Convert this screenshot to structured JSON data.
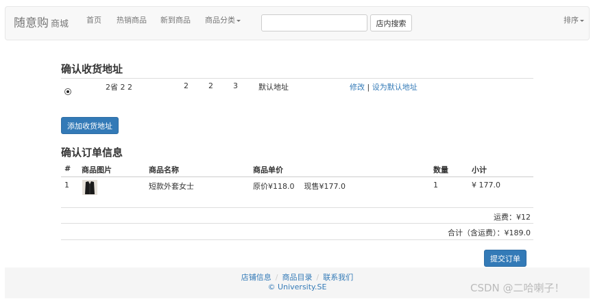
{
  "navbar": {
    "brand": "随意购",
    "brand_sub": "商城",
    "links": [
      "首页",
      "热销商品",
      "新到商品"
    ],
    "category_dropdown": "商品分类",
    "search_value": "",
    "search_placeholder": "",
    "search_button": "店内搜索",
    "sort_dropdown": "排序"
  },
  "address_section": {
    "title": "确认收货地址",
    "address": {
      "region": "2省 2 2",
      "field1": "2",
      "field2": "2",
      "field3": "3",
      "label": "默认地址",
      "edit_link": "修改",
      "separator": "|",
      "set_default_link": "设为默认地址",
      "selected": true
    },
    "add_button": "添加收货地址"
  },
  "order_section": {
    "title": "确认订单信息",
    "headers": [
      "#",
      "商品图片",
      "商品名称",
      "商品单价",
      "数量",
      "小计"
    ],
    "rows": [
      {
        "index": "1",
        "name": "短款外套女士",
        "price_text": "原价¥118.0    现售¥177.0",
        "quantity": "1",
        "subtotal": "¥ 177.0"
      }
    ],
    "shipping": "运费：¥12",
    "total": "合计（含运费）：¥189.0",
    "submit_button": "提交订单"
  },
  "footer": {
    "links": [
      "店铺信息",
      "商品目录",
      "联系我们"
    ],
    "separator": "/",
    "copyright": "© University.SE"
  },
  "watermark": "CSDN @二哈喇子！",
  "colors": {
    "accent": "#337ab7",
    "navbar_bg": "#f8f8f8",
    "footer_bg": "#f5f5f5"
  }
}
